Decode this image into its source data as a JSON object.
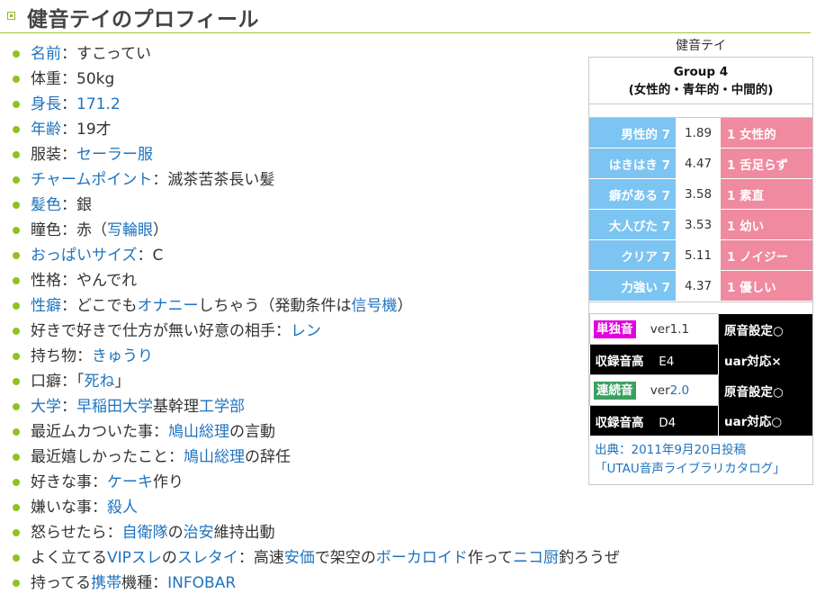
{
  "title": "健音テイのプロフィール",
  "profile": [
    {
      "label": "名前",
      "label_link": true,
      "sep": "：",
      "value": "すこってい"
    },
    {
      "label": "体重",
      "sep": "：",
      "value": "50kg"
    },
    {
      "label": "身長",
      "label_link": true,
      "sep": "：",
      "value": "171.2",
      "value_link": true
    },
    {
      "label": "年齢",
      "label_link": true,
      "sep": "：",
      "value": "19才"
    },
    {
      "label": "服装",
      "sep": "：",
      "value": "セーラー服",
      "value_link": true
    },
    {
      "label": "チャームポイント",
      "label_link": true,
      "sep": "：",
      "value": "滅茶苦茶長い髪"
    },
    {
      "label": "髪色",
      "label_link": true,
      "sep": "：",
      "value": "銀"
    },
    {
      "label": "瞳色",
      "sep": "：",
      "value_pre": "赤（",
      "value_link_text": "写輪眼",
      "value_post": "）"
    },
    {
      "label": "おっぱいサイズ",
      "label_link": true,
      "sep": "：",
      "value": "C"
    },
    {
      "label": "性格",
      "sep": "：",
      "value": "やんでれ"
    },
    {
      "label": "性癖",
      "label_link": true,
      "sep": "：",
      "value_pre": "どこでも",
      "value_link_text": "オナニー",
      "value_post": "しちゃう（発動条件は",
      "value_link2": "信号機",
      "value_post2": "）"
    },
    {
      "label": "好きで好きで仕方が無い好意の相手",
      "sep": "：",
      "value": "レン",
      "value_link": true
    },
    {
      "label": "持ち物",
      "sep": "：",
      "value": "きゅうり",
      "value_link": true
    },
    {
      "label": "口癖",
      "sep": "：",
      "value_pre": "「",
      "value_link_text": "死ね",
      "value_post": "」"
    },
    {
      "label": "大学",
      "label_link": true,
      "sep": "：",
      "value_pre": "",
      "value_link_text": "早稲田大学",
      "value_post": "基幹理",
      "value_link2": "工学部",
      "value_post2": ""
    },
    {
      "label": "最近ムカついた事",
      "sep": "：",
      "value_pre": "",
      "value_link_text": "鳩山総理",
      "value_post": "の言動"
    },
    {
      "label": "最近嬉しかったこと",
      "sep": "：",
      "value_pre": "",
      "value_link_text": "鳩山総理",
      "value_post": "の辞任"
    },
    {
      "label": "好きな事",
      "sep": "：",
      "value_pre": "",
      "value_link_text": "ケーキ",
      "value_post": "作り"
    },
    {
      "label": "嫌いな事",
      "sep": "：",
      "value": "殺人",
      "value_link": true
    },
    {
      "label": "怒らせたら",
      "sep": "：",
      "value_pre": "",
      "value_link_text": "自衛隊",
      "value_post": "の",
      "value_link2": "治安",
      "value_post2": "維持出動"
    },
    {
      "label": "よく立てるVIPスレのスレタイ",
      "sep": "：",
      "complex": true
    },
    {
      "label": "持ってる携帯機種",
      "sep": "：",
      "value": "INFOBAR",
      "value_link": true
    }
  ],
  "vip_line": {
    "pre": "よく立てる",
    "l1": "VIP",
    "m1": "スレ",
    "m2": "の",
    "l2": "スレタイ",
    "sep": "：高速",
    "l3": "安価",
    "m3": "で架空の",
    "l4": "ボーカロイド",
    "m4": "作って",
    "l5": "ニコ厨",
    "m5": "釣ろうぜ"
  },
  "carrier_line": {
    "pre": "持ってる",
    "l1": "携帯",
    "m1": "機種",
    "sep": "：",
    "l2": "INFOBAR"
  },
  "sidebar": {
    "caption": "健音テイ",
    "group": "Group 4",
    "group_sub": "(女性的・青年的・中間的)",
    "axes": [
      {
        "left": "男性的 7",
        "value": "1.89",
        "right": "1 女性的"
      },
      {
        "left": "はきはき 7",
        "value": "4.47",
        "right": "1 舌足らず"
      },
      {
        "left": "癖がある 7",
        "value": "3.58",
        "right": "1 素直"
      },
      {
        "left": "大人びた 7",
        "value": "3.53",
        "right": "1 幼い"
      },
      {
        "left": "クリア 7",
        "value": "5.11",
        "right": "1 ノイジー"
      },
      {
        "left": "力強い 7",
        "value": "4.37",
        "right": "1 優しい"
      }
    ],
    "single": {
      "tag": "単独音",
      "ver": "ver1.1",
      "setting": "原音設定○",
      "range_label": "収録音高",
      "range": "E4",
      "uar": "uar対応×"
    },
    "multi": {
      "tag": "連続音",
      "ver_pre": "ver",
      "ver_num": "2.0",
      "setting": "原音設定○",
      "range_label": "収録音高",
      "range": "D4",
      "uar": "uar対応○"
    },
    "source_line1": "出典：2011年9月20日投稿",
    "source_line2": "「UTAU音声ライブラリカタログ」"
  },
  "colors": {
    "accent": "#8ec31f",
    "link": "#1e73be",
    "blue_cell": "#7cc4f2",
    "pink_cell": "#f08aa0",
    "magenta_tag": "#e000e0",
    "green_tag": "#3aa060"
  }
}
